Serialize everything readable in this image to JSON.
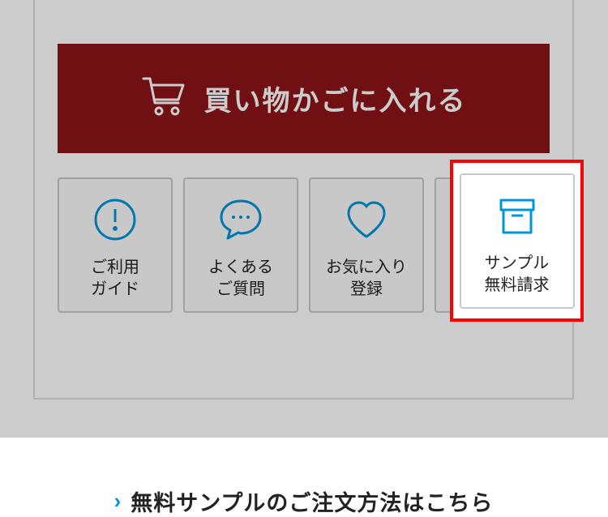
{
  "cart": {
    "label": "買い物かごに入れる"
  },
  "tiles": {
    "guide": {
      "line1": "ご利用",
      "line2": "ガイド"
    },
    "faq": {
      "line1": "よくある",
      "line2": "ご質問"
    },
    "fav": {
      "line1": "お気に入り",
      "line2": "登録"
    },
    "sample": {
      "line1": "サンプル",
      "line2": "無料請求"
    }
  },
  "sample_link": {
    "text": "無料サンプルのご注文方法はこちら"
  },
  "colors": {
    "accent": "#0095d9",
    "cart_bg": "#8d1518",
    "highlight": "#ff0000"
  }
}
